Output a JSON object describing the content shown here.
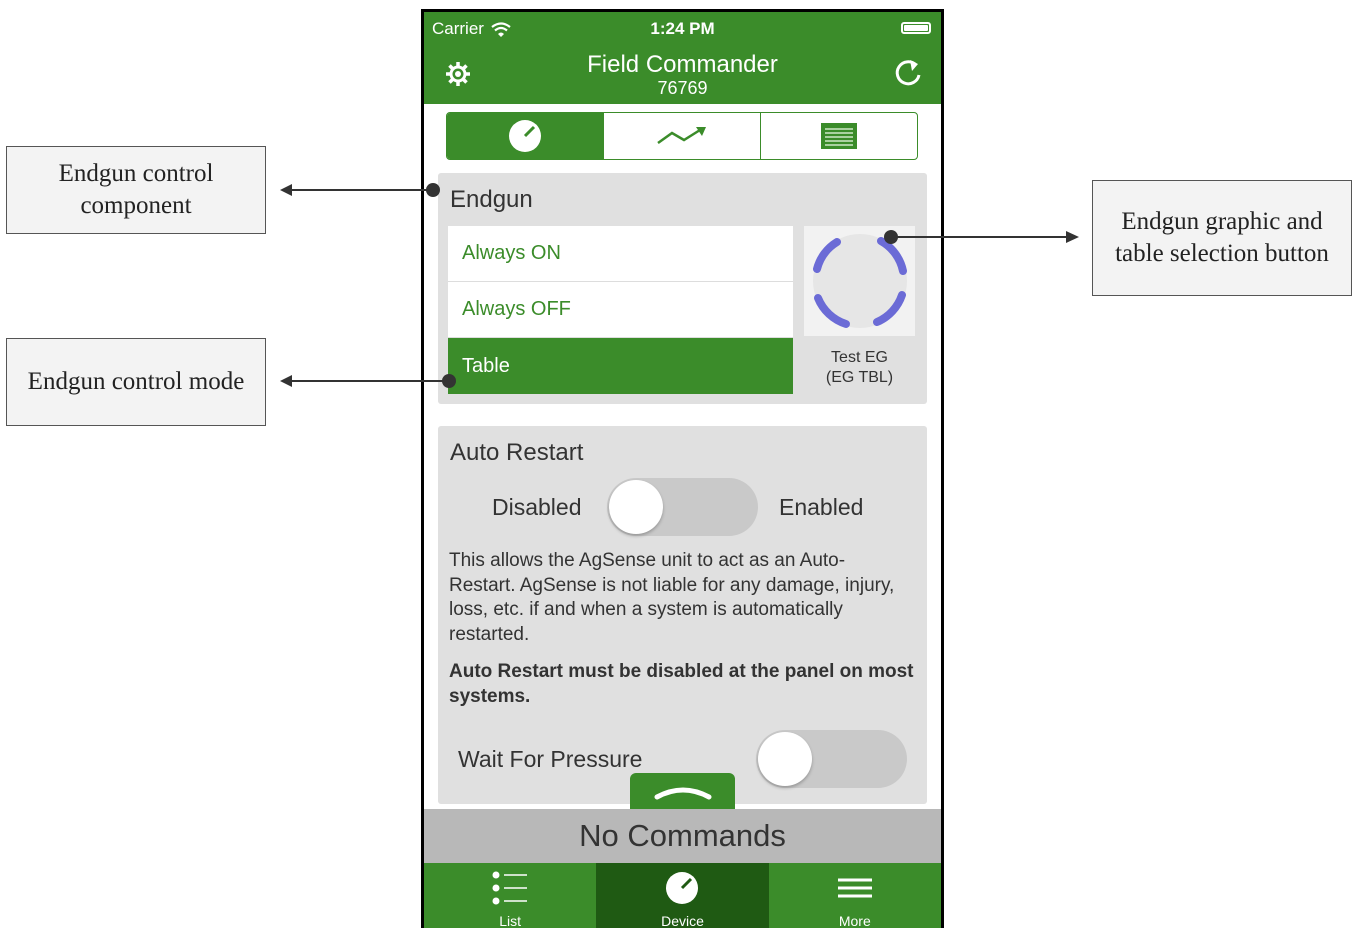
{
  "callouts": {
    "component": [
      "Endgun control",
      "component"
    ],
    "mode": "Endgun control mode",
    "graphic": [
      "Endgun graphic and",
      "table selection button"
    ]
  },
  "statusbar": {
    "carrier": "Carrier",
    "time": "1:24 PM"
  },
  "navbar": {
    "title": "Field Commander",
    "subtitle": "76769"
  },
  "segments": {
    "icons": [
      "gauge-icon",
      "trend-icon",
      "table-icon"
    ],
    "selected": 0
  },
  "endgun": {
    "title": "Endgun",
    "modes": [
      "Always ON",
      "Always OFF",
      "Table"
    ],
    "selected_mode": "Table",
    "eg_name": "Test EG",
    "eg_table": "(EG TBL)"
  },
  "auto_restart": {
    "title": "Auto Restart",
    "off_label": "Disabled",
    "on_label": "Enabled",
    "enabled": false,
    "description": "This allows the AgSense unit to act as an Auto-Restart.  AgSense is not liable for any damage, injury, loss, etc. if and when a system is automatically restarted.",
    "warning": "Auto Restart must be disabled at the panel on most systems.",
    "wait_label": "Wait For Pressure",
    "wait_enabled": false
  },
  "command_bar": "No Commands",
  "tabbar": {
    "tabs": [
      {
        "label": "List",
        "icon": "list-icon"
      },
      {
        "label": "Device",
        "icon": "gauge-icon"
      },
      {
        "label": "More",
        "icon": "menu-icon"
      }
    ],
    "active": "Device"
  },
  "colors": {
    "primary": "#3b8c2a",
    "active_tab": "#1f5a13",
    "card": "#e0e0e0",
    "endgun_arc": "#6b6bd6"
  }
}
